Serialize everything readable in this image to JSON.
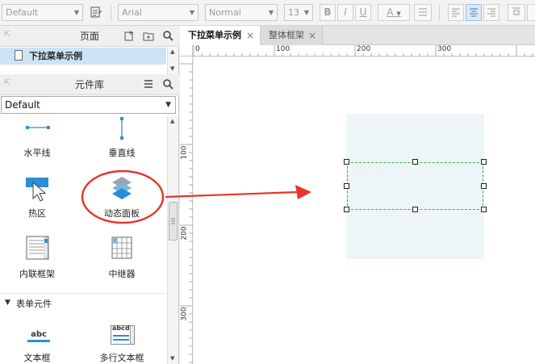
{
  "toolbar": {
    "style_select": "Default",
    "font_select": "Arial",
    "weight_select": "Normal",
    "size_select": "13",
    "bold": "B",
    "italic": "I",
    "underline": "U",
    "font_color": "A"
  },
  "pages_panel": {
    "title": "页面",
    "items": [
      {
        "label": "下拉菜单示例"
      }
    ]
  },
  "library_panel": {
    "title": "元件库",
    "selected_library": "Default",
    "widgets": [
      {
        "label": "水平线",
        "icon": "horizontal-line-icon"
      },
      {
        "label": "垂直线",
        "icon": "vertical-line-icon"
      },
      {
        "label": "热区",
        "icon": "hotspot-icon"
      },
      {
        "label": "动态面板",
        "icon": "dynamic-panel-icon"
      },
      {
        "label": "内联框架",
        "icon": "inline-frame-icon"
      },
      {
        "label": "中继器",
        "icon": "repeater-icon"
      }
    ],
    "section": "表单元件",
    "form_widgets": [
      {
        "label": "文本框",
        "icon": "text-field-icon",
        "icon_text": "abc"
      },
      {
        "label": "多行文本框",
        "icon": "text-area-icon",
        "icon_text": "abcd"
      }
    ]
  },
  "tabs": [
    {
      "label": "下拉菜单示例",
      "active": true
    },
    {
      "label": "整体框架",
      "active": false
    }
  ],
  "ruler": {
    "top": [
      "0",
      "100",
      "200",
      "300"
    ],
    "left": [
      "100",
      "200",
      "300"
    ]
  },
  "colors": {
    "selected_page": "#cde4f6",
    "annotation": "#e8352a",
    "dynamic_panel": "#eef5f9",
    "selection_border": "#35b435"
  }
}
